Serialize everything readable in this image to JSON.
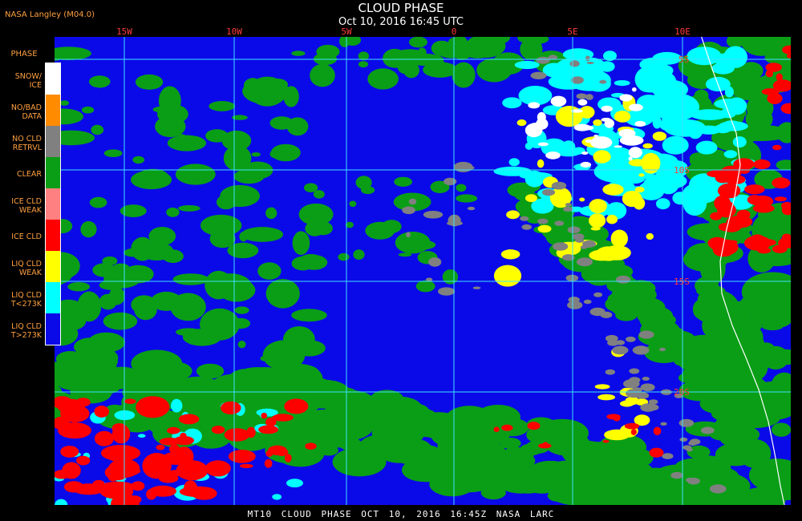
{
  "header": {
    "credit": "NASA Langley (M04.0)",
    "title": "CLOUD PHASE",
    "subtitle": "Oct 10, 2016 16:45 UTC"
  },
  "footer": {
    "caption": "MT10  CLOUD PHASE  OCT 10, 2016 16:45Z  NASA LARC"
  },
  "map": {
    "lon_labels": [
      "15W",
      "10W",
      "5W",
      "0",
      "5E",
      "10E"
    ],
    "lat_labels": [
      "5S",
      "10S",
      "15S",
      "20S"
    ],
    "colors": {
      "ocean": "#0a0ae8",
      "clear": "#0a9e16",
      "liq_weak": "#ffff00",
      "liq_cold": "#00ffff",
      "ice": "#ff0000",
      "no_retrieval": "#808080",
      "snow_ice": "#ffffff",
      "grid": "#40e0ff"
    }
  },
  "legend": {
    "title": "PHASE",
    "items": [
      {
        "label": "SNOW/\nICE",
        "color": "#ffffff"
      },
      {
        "label": "NO/BAD\nDATA",
        "color": "#ff8c00"
      },
      {
        "label": "NO CLD\nRETRVL",
        "color": "#808080"
      },
      {
        "label": "CLEAR",
        "color": "#0a9e16"
      },
      {
        "label": "ICE CLD\nWEAK",
        "color": "#ff8080"
      },
      {
        "label": "ICE CLD",
        "color": "#ff0000"
      },
      {
        "label": "LIQ CLD\nWEAK",
        "color": "#ffff00"
      },
      {
        "label": "LIQ CLD\nT<273K",
        "color": "#00ffff"
      },
      {
        "label": "LIQ CLD\nT>273K",
        "color": "#0a0ae8"
      }
    ]
  }
}
